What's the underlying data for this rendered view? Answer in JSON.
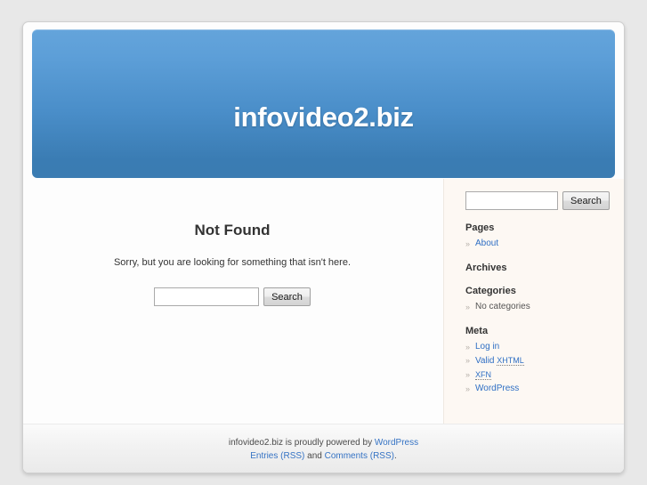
{
  "header": {
    "blog_title": "infovideo2.biz"
  },
  "main": {
    "title": "Not Found",
    "message": "Sorry, but you are looking for something that isn't here.",
    "search": {
      "value": "",
      "placeholder": "",
      "button_label": "Search"
    }
  },
  "sidebar": {
    "search": {
      "value": "",
      "placeholder": "",
      "button_label": "Search"
    },
    "bullet": "»",
    "widgets": [
      {
        "title": "Pages",
        "items": [
          {
            "label": "About",
            "link": true
          }
        ]
      },
      {
        "title": "Archives",
        "items": []
      },
      {
        "title": "Categories",
        "items": [
          {
            "label": "No categories",
            "link": false
          }
        ]
      },
      {
        "title": "Meta",
        "items": [
          {
            "label": "Log in",
            "link": true
          },
          {
            "label": "Valid XHTML",
            "link": true,
            "abbr": "XHTML",
            "prefix": "Valid "
          },
          {
            "label": "XFN",
            "link": true,
            "abbr": "XFN",
            "prefix": ""
          },
          {
            "label": "WordPress",
            "link": true
          }
        ]
      }
    ]
  },
  "footer": {
    "line1_prefix": "infovideo2.biz is proudly powered by ",
    "line1_link": "WordPress",
    "line2_link1": "Entries (RSS)",
    "line2_middle": " and ",
    "line2_link2": "Comments (RSS)",
    "line2_suffix": "."
  }
}
